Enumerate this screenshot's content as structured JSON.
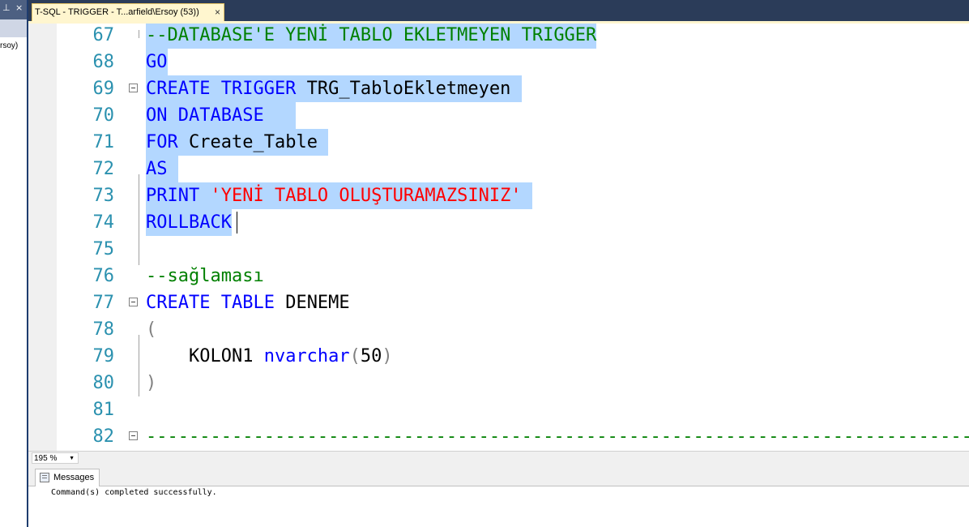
{
  "left_panel": {
    "pin_glyph": "q",
    "close_glyph": "×",
    "fragment_text": "rsoy)"
  },
  "tab": {
    "title": "T-SQL - TRIGGER - T...arfield\\Ersoy (53))",
    "close": "×"
  },
  "editor": {
    "lines": [
      {
        "num": "67",
        "parts": [
          {
            "t": "--DATABASE'E YENİ TABLO EKLETMEYEN TRIGGER",
            "c": "cm"
          }
        ]
      },
      {
        "num": "68",
        "parts": [
          {
            "t": "GO",
            "c": "kw"
          }
        ]
      },
      {
        "num": "69",
        "parts": [
          {
            "t": "CREATE TRIGGER",
            "c": "kw"
          },
          {
            "t": " TRG_TabloEkletmeyen ",
            "c": "tx"
          }
        ]
      },
      {
        "num": "70",
        "parts": [
          {
            "t": "ON DATABASE",
            "c": "kw"
          },
          {
            "t": "   ",
            "c": "tx"
          }
        ]
      },
      {
        "num": "71",
        "parts": [
          {
            "t": "FOR",
            "c": "kw"
          },
          {
            "t": " Create_Table ",
            "c": "tx"
          }
        ]
      },
      {
        "num": "72",
        "parts": [
          {
            "t": "AS",
            "c": "kw"
          },
          {
            "t": " ",
            "c": "tx"
          }
        ]
      },
      {
        "num": "73",
        "parts": [
          {
            "t": "PRINT",
            "c": "kw"
          },
          {
            "t": " ",
            "c": "tx"
          },
          {
            "t": "'YENİ TABLO OLUŞTURAMAZSINIZ'",
            "c": "st"
          },
          {
            "t": " ",
            "c": "tx"
          }
        ]
      },
      {
        "num": "74",
        "parts": [
          {
            "t": "ROLLBACK",
            "c": "kw"
          }
        ]
      },
      {
        "num": "75",
        "parts": []
      },
      {
        "num": "76",
        "parts": [
          {
            "t": "--sağlaması",
            "c": "cm"
          }
        ]
      },
      {
        "num": "77",
        "parts": [
          {
            "t": "CREATE TABLE",
            "c": "kw"
          },
          {
            "t": " DENEME",
            "c": "tx"
          }
        ]
      },
      {
        "num": "78",
        "parts": [
          {
            "t": "(",
            "c": "gr"
          }
        ]
      },
      {
        "num": "79",
        "parts": [
          {
            "t": "    KOLON1 ",
            "c": "tx"
          },
          {
            "t": "nvarchar",
            "c": "kw"
          },
          {
            "t": "(",
            "c": "gr"
          },
          {
            "t": "50",
            "c": "tx"
          },
          {
            "t": ")",
            "c": "gr"
          }
        ]
      },
      {
        "num": "80",
        "parts": [
          {
            "t": ")",
            "c": "gr"
          }
        ]
      },
      {
        "num": "81",
        "parts": []
      },
      {
        "num": "82",
        "parts": [
          {
            "t": "---------------------------------------------------------------------------------------------------------------------------------------------------------------------------------------------------------------------------------------------------",
            "c": "cm"
          }
        ]
      }
    ]
  },
  "zoom": {
    "value": "195 %",
    "arrow": "▼"
  },
  "messages": {
    "tab_label": "Messages",
    "text": "Command(s) completed successfully."
  }
}
